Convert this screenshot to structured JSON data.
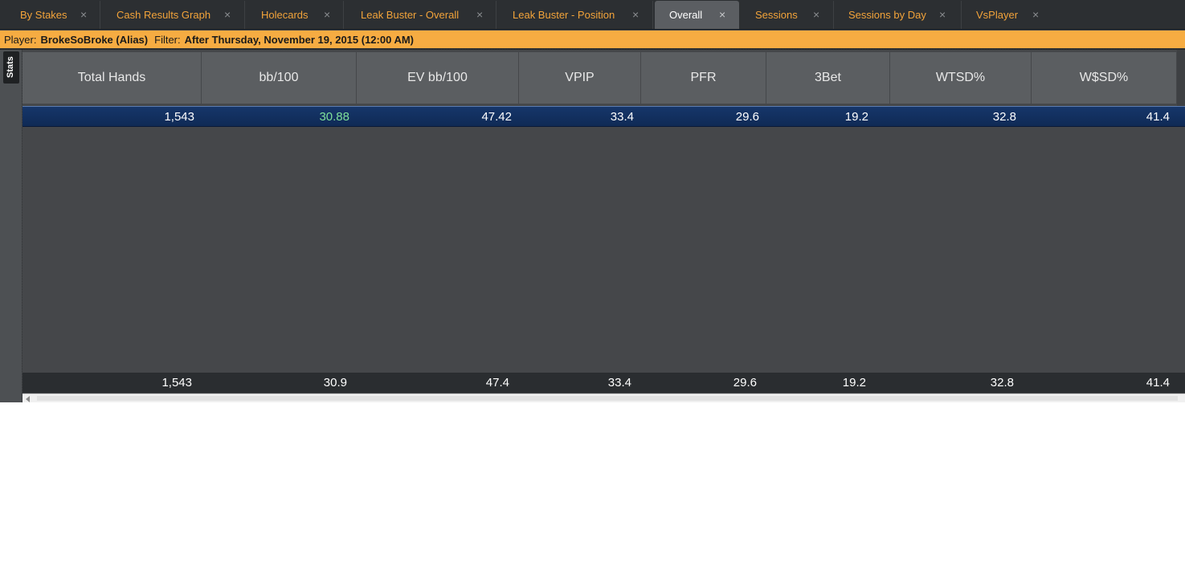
{
  "tabs": [
    {
      "label": "By Stakes",
      "close": "×",
      "active": false
    },
    {
      "label": "Cash Results Graph",
      "close": "×",
      "active": false
    },
    {
      "label": "Holecards",
      "close": "×",
      "active": false
    },
    {
      "label": "Leak Buster - Overall",
      "close": "×",
      "active": false
    },
    {
      "label": "Leak Buster - Position",
      "close": "×",
      "active": false
    },
    {
      "label": "Overall",
      "close": "×",
      "active": true
    },
    {
      "label": "Sessions",
      "close": "×",
      "active": false
    },
    {
      "label": "Sessions by Day",
      "close": "×",
      "active": false
    },
    {
      "label": "VsPlayer",
      "close": "×",
      "active": false
    }
  ],
  "filter_bar": {
    "player_label": "Player:",
    "player_value": "BrokeSoBroke (Alias)",
    "filter_label": "Filter:",
    "filter_value": "After Thursday, November 19, 2015 (12:00 AM)"
  },
  "sidebar": {
    "stats_tab": "Stats"
  },
  "table": {
    "columns": [
      "Total Hands",
      "bb/100",
      "EV bb/100",
      "VPIP",
      "PFR",
      "3Bet",
      "WTSD%",
      "W$SD%"
    ],
    "row": [
      "1,543",
      "30.88",
      "47.42",
      "33.4",
      "29.6",
      "19.2",
      "32.8",
      "41.4"
    ],
    "totals": [
      "1,543",
      "30.9",
      "47.4",
      "33.4",
      "29.6",
      "19.2",
      "32.8",
      "41.4"
    ]
  },
  "colors": {
    "tab_text": "#f2a33a",
    "filter_bar": "#f6ac42",
    "selected_row": "#16366a",
    "positive_value": "#7fe09a"
  }
}
